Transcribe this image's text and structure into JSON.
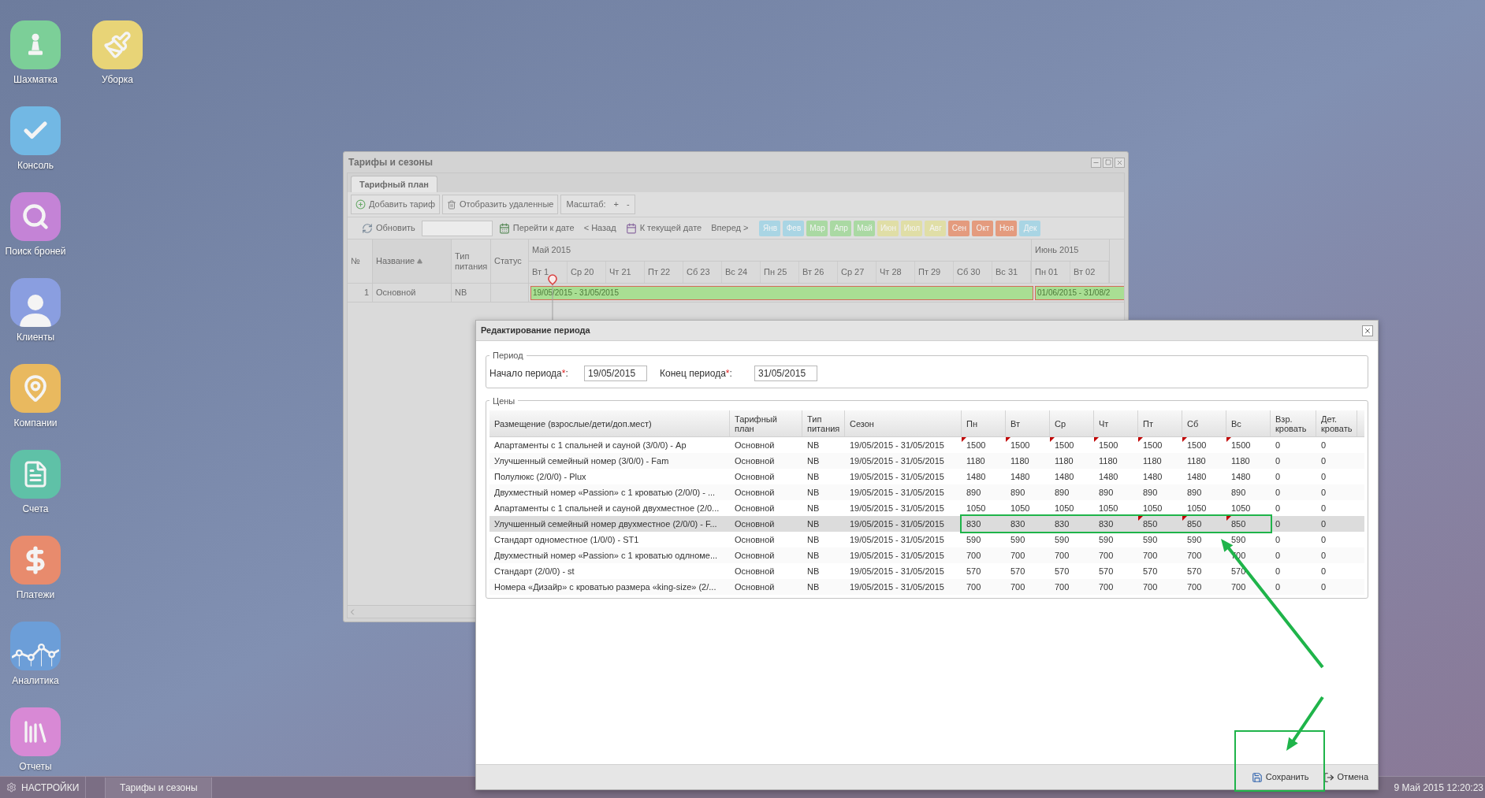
{
  "desktop": {
    "columns": [
      {
        "icons": [
          {
            "label": "Шахматка",
            "kind": "pawn",
            "color": "#7ccf98"
          },
          {
            "label": "Консоль",
            "kind": "check",
            "color": "#72b8e4"
          },
          {
            "label": "Поиск броней",
            "kind": "search",
            "color": "#c483d6"
          },
          {
            "label": "Клиенты",
            "kind": "person",
            "color": "#8a9ee0"
          },
          {
            "label": "Компании",
            "kind": "pin",
            "color": "#e9b95f"
          },
          {
            "label": "Счета",
            "kind": "document",
            "color": "#5fc1a7"
          },
          {
            "label": "Платежи",
            "kind": "dollar",
            "color": "#e88b6d"
          },
          {
            "label": "Аналитика",
            "kind": "chart",
            "color": "#6c9ed8"
          },
          {
            "label": "Отчеты",
            "kind": "books",
            "color": "#d889d5"
          }
        ]
      },
      {
        "icons": [
          {
            "label": "Уборка",
            "kind": "brush",
            "color": "#e8d477"
          }
        ]
      }
    ]
  },
  "tariffs_window": {
    "title": "Тарифы и сезоны",
    "tabs": [
      {
        "label": "Тарифный план",
        "selected": true
      }
    ],
    "toolbar": [
      {
        "label": "Добавить тариф",
        "kind": "add"
      },
      {
        "label": "Отобразить удаленные",
        "kind": "trash"
      }
    ],
    "scale": {
      "label": "Масштаб:",
      "buttons": [
        "+",
        "-"
      ]
    },
    "nav": [
      {
        "label": "Обновить",
        "kind": "refresh"
      },
      {
        "kind": "search"
      },
      {
        "label": "Перейти к дате",
        "kind": "goto"
      },
      {
        "label": "< Назад",
        "kind": "plain"
      },
      {
        "label": "К текущей дате",
        "kind": "today"
      },
      {
        "label": "Вперед >",
        "kind": "plain"
      }
    ],
    "months": [
      {
        "label": "Янв",
        "color": "#a9d5e4"
      },
      {
        "label": "Фев",
        "color": "#a9d5e4"
      },
      {
        "label": "Мар",
        "color": "#aad9a3"
      },
      {
        "label": "Апр",
        "color": "#aad9a3"
      },
      {
        "label": "Май",
        "color": "#aad9a3"
      },
      {
        "label": "Июн",
        "color": "#e0dea6"
      },
      {
        "label": "Июл",
        "color": "#e0dea6"
      },
      {
        "label": "Авг",
        "color": "#e0dea6"
      },
      {
        "label": "Сен",
        "color": "#e49b7e"
      },
      {
        "label": "Окт",
        "color": "#e49b7e"
      },
      {
        "label": "Ноя",
        "color": "#e49b7e"
      },
      {
        "label": "Дек",
        "color": "#a9d5e4"
      }
    ],
    "columns": [
      {
        "label": "№",
        "sorted": false
      },
      {
        "label": "Название",
        "sorted": true
      },
      {
        "label": "Тип питания",
        "sorted": false
      },
      {
        "label": "Статус",
        "sorted": false
      }
    ],
    "timeline": {
      "months": [
        {
          "label": "Май 2015",
          "days": [
            "Вт 1",
            "Ср 20",
            "Чт 21",
            "Пт 22",
            "Сб 23",
            "Вс 24",
            "Пн 25",
            "Вт 26",
            "Ср 27",
            "Чт 28",
            "Пт 29",
            "Сб 30",
            "Вс 31"
          ]
        },
        {
          "label": "Июнь 2015",
          "days": [
            "Пн 01",
            "Вт 02"
          ]
        }
      ]
    },
    "rows": [
      {
        "number": "1",
        "name": "Основной",
        "meal": "NB",
        "periods": [
          {
            "label": "19/05/2015 - 31/05/2015"
          },
          {
            "label": "01/06/2015 - 31/08/2"
          }
        ]
      }
    ]
  },
  "dialog": {
    "title": "Редактирование периода",
    "period": {
      "legend": "Период",
      "fields": [
        {
          "label": "Начало периода",
          "mark": "*",
          "colon": ":",
          "value": "19/05/2015"
        },
        {
          "label": "Конец периода",
          "mark": "*",
          "colon": ":",
          "value": "31/05/2015"
        }
      ]
    },
    "prices": {
      "legend": "Цены",
      "columns": [
        "Размещение (взрослые/дети/доп.мест)",
        "Тарифный план",
        "Тип питания",
        "Сезон",
        "Пн",
        "Вт",
        "Ср",
        "Чт",
        "Пт",
        "Сб",
        "Вс",
        "Взр. кровать",
        "Дет. кровать"
      ],
      "rows": [
        {
          "placement": "Апартаменты с 1 спальней и сауной (3/0/0) - Ap",
          "plan": "Основной",
          "meal": "NB",
          "season": "19/05/2015 - 31/05/2015",
          "selected": false,
          "prices": [
            {
              "value": "1500",
              "modified": true
            },
            {
              "value": "1500",
              "modified": true
            },
            {
              "value": "1500",
              "modified": true
            },
            {
              "value": "1500",
              "modified": true
            },
            {
              "value": "1500",
              "modified": true
            },
            {
              "value": "1500",
              "modified": true
            },
            {
              "value": "1500",
              "modified": true
            }
          ],
          "adult_bed": "0",
          "child_bed": "0"
        },
        {
          "placement": "Улучшенный семейный номер (3/0/0) - Fam",
          "plan": "Основной",
          "meal": "NB",
          "season": "19/05/2015 - 31/05/2015",
          "selected": false,
          "prices": [
            {
              "value": "1180",
              "modified": false
            },
            {
              "value": "1180",
              "modified": false
            },
            {
              "value": "1180",
              "modified": false
            },
            {
              "value": "1180",
              "modified": false
            },
            {
              "value": "1180",
              "modified": false
            },
            {
              "value": "1180",
              "modified": false
            },
            {
              "value": "1180",
              "modified": false
            }
          ],
          "adult_bed": "0",
          "child_bed": "0"
        },
        {
          "placement": "Полулюкс (2/0/0) - Plux",
          "plan": "Основной",
          "meal": "NB",
          "season": "19/05/2015 - 31/05/2015",
          "selected": false,
          "prices": [
            {
              "value": "1480",
              "modified": false
            },
            {
              "value": "1480",
              "modified": false
            },
            {
              "value": "1480",
              "modified": false
            },
            {
              "value": "1480",
              "modified": false
            },
            {
              "value": "1480",
              "modified": false
            },
            {
              "value": "1480",
              "modified": false
            },
            {
              "value": "1480",
              "modified": false
            }
          ],
          "adult_bed": "0",
          "child_bed": "0"
        },
        {
          "placement": "Двухместный номер «Passion» с 1 кроватью (2/0/0) - ...",
          "plan": "Основной",
          "meal": "NB",
          "season": "19/05/2015 - 31/05/2015",
          "selected": false,
          "prices": [
            {
              "value": "890",
              "modified": false
            },
            {
              "value": "890",
              "modified": false
            },
            {
              "value": "890",
              "modified": false
            },
            {
              "value": "890",
              "modified": false
            },
            {
              "value": "890",
              "modified": false
            },
            {
              "value": "890",
              "modified": false
            },
            {
              "value": "890",
              "modified": false
            }
          ],
          "adult_bed": "0",
          "child_bed": "0"
        },
        {
          "placement": "Апартаменты с 1 спальней и сауной двухместное (2/0...",
          "plan": "Основной",
          "meal": "NB",
          "season": "19/05/2015 - 31/05/2015",
          "selected": false,
          "prices": [
            {
              "value": "1050",
              "modified": false
            },
            {
              "value": "1050",
              "modified": false
            },
            {
              "value": "1050",
              "modified": false
            },
            {
              "value": "1050",
              "modified": false
            },
            {
              "value": "1050",
              "modified": false
            },
            {
              "value": "1050",
              "modified": false
            },
            {
              "value": "1050",
              "modified": false
            }
          ],
          "adult_bed": "0",
          "child_bed": "0"
        },
        {
          "placement": "Улучшенный семейный номер двухместное (2/0/0) - F...",
          "plan": "Основной",
          "meal": "NB",
          "season": "19/05/2015 - 31/05/2015",
          "selected": true,
          "prices": [
            {
              "value": "830",
              "modified": false
            },
            {
              "value": "830",
              "modified": false
            },
            {
              "value": "830",
              "modified": false
            },
            {
              "value": "830",
              "modified": false
            },
            {
              "value": "850",
              "modified": true
            },
            {
              "value": "850",
              "modified": true
            },
            {
              "value": "850",
              "modified": true
            }
          ],
          "adult_bed": "0",
          "child_bed": "0"
        },
        {
          "placement": "Стандарт одноместное (1/0/0) - ST1",
          "plan": "Основной",
          "meal": "NB",
          "season": "19/05/2015 - 31/05/2015",
          "selected": false,
          "prices": [
            {
              "value": "590",
              "modified": false
            },
            {
              "value": "590",
              "modified": false
            },
            {
              "value": "590",
              "modified": false
            },
            {
              "value": "590",
              "modified": false
            },
            {
              "value": "590",
              "modified": false
            },
            {
              "value": "590",
              "modified": false
            },
            {
              "value": "590",
              "modified": false
            }
          ],
          "adult_bed": "0",
          "child_bed": "0"
        },
        {
          "placement": "Двухместный номер «Passion» с 1 кроватью одлноме...",
          "plan": "Основной",
          "meal": "NB",
          "season": "19/05/2015 - 31/05/2015",
          "selected": false,
          "prices": [
            {
              "value": "700",
              "modified": false
            },
            {
              "value": "700",
              "modified": false
            },
            {
              "value": "700",
              "modified": false
            },
            {
              "value": "700",
              "modified": false
            },
            {
              "value": "700",
              "modified": false
            },
            {
              "value": "700",
              "modified": false
            },
            {
              "value": "700",
              "modified": false
            }
          ],
          "adult_bed": "0",
          "child_bed": "0"
        },
        {
          "placement": "Стандарт (2/0/0) - st",
          "plan": "Основной",
          "meal": "NB",
          "season": "19/05/2015 - 31/05/2015",
          "selected": false,
          "prices": [
            {
              "value": "570",
              "modified": false
            },
            {
              "value": "570",
              "modified": false
            },
            {
              "value": "570",
              "modified": false
            },
            {
              "value": "570",
              "modified": false
            },
            {
              "value": "570",
              "modified": false
            },
            {
              "value": "570",
              "modified": false
            },
            {
              "value": "570",
              "modified": false
            }
          ],
          "adult_bed": "0",
          "child_bed": "0"
        },
        {
          "placement": "Номера «Дизайр» с кроватью размера «king-size» (2/...",
          "plan": "Основной",
          "meal": "NB",
          "season": "19/05/2015 - 31/05/2015",
          "selected": false,
          "prices": [
            {
              "value": "700",
              "modified": false
            },
            {
              "value": "700",
              "modified": false
            },
            {
              "value": "700",
              "modified": false
            },
            {
              "value": "700",
              "modified": false
            },
            {
              "value": "700",
              "modified": false
            },
            {
              "value": "700",
              "modified": false
            },
            {
              "value": "700",
              "modified": false
            }
          ],
          "adult_bed": "0",
          "child_bed": "0"
        }
      ]
    },
    "buttons": [
      {
        "label": "Сохранить",
        "kind": "save"
      },
      {
        "label": "Отмена",
        "kind": "cancel"
      }
    ]
  },
  "taskbar": {
    "start": "НАСТРОЙКИ",
    "tasks": [
      "Тарифы и сезоны"
    ],
    "clock": "9 Май 2015 12:20:23"
  }
}
